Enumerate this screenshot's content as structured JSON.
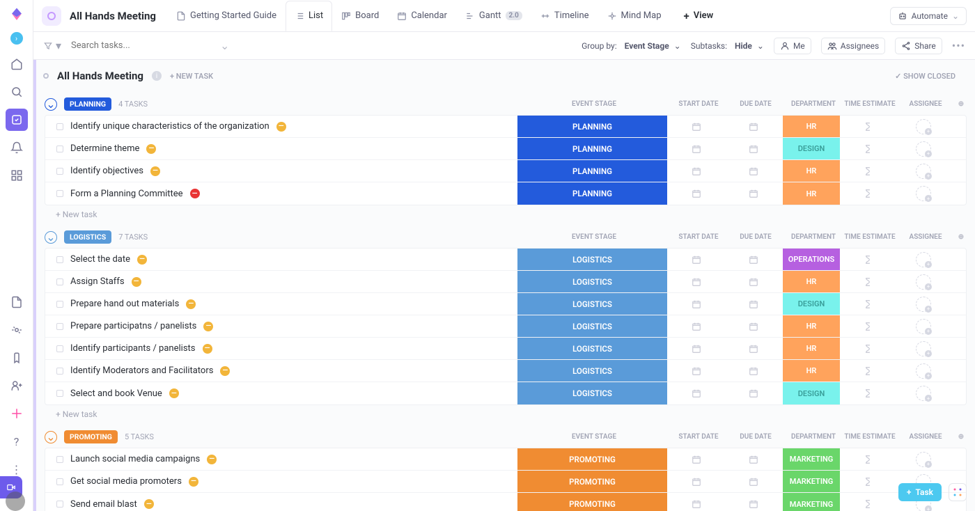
{
  "header": {
    "page_title": "All Hands Meeting",
    "automate": "Automate",
    "views": [
      {
        "label": "Getting Started Guide",
        "icon": "doc"
      },
      {
        "label": "List",
        "icon": "list",
        "active": true
      },
      {
        "label": "Board",
        "icon": "board"
      },
      {
        "label": "Calendar",
        "icon": "calendar"
      },
      {
        "label": "Gantt",
        "icon": "gantt",
        "badge": "2.0"
      },
      {
        "label": "Timeline",
        "icon": "timeline"
      },
      {
        "label": "Mind Map",
        "icon": "mindmap"
      }
    ],
    "add_view": "View"
  },
  "toolbar": {
    "search_placeholder": "Search tasks...",
    "group_by_label": "Group by:",
    "group_by_value": "Event Stage",
    "subtasks_label": "Subtasks:",
    "subtasks_value": "Hide",
    "me": "Me",
    "assignees": "Assignees",
    "share": "Share"
  },
  "list": {
    "title": "All Hands Meeting",
    "new_task": "+ NEW TASK",
    "show_closed": "SHOW CLOSED",
    "new_task_row": "+ New task"
  },
  "columns": {
    "stage": "EVENT STAGE",
    "start": "START DATE",
    "due": "DUE DATE",
    "dept": "DEPARTMENT",
    "time": "TIME ESTIMATE",
    "assignee": "ASSIGNEE"
  },
  "dept_colors": {
    "HR": "#ffa35c",
    "DESIGN": "#79f2ec",
    "OPERATIONS": "#b660e0",
    "MARKETING": "#6ad66a"
  },
  "groups": [
    {
      "name": "PLANNING",
      "color": "#235bdc",
      "accent": "#235bdc",
      "count": "4 TASKS",
      "tasks": [
        {
          "name": "Identify unique characteristics of the organization",
          "dept": "HR",
          "pri": "#f2b53a"
        },
        {
          "name": "Determine theme",
          "dept": "DESIGN",
          "pri": "#f2b53a"
        },
        {
          "name": "Identify objectives",
          "dept": "HR",
          "pri": "#f2b53a"
        },
        {
          "name": "Form a Planning Committee",
          "dept": "HR",
          "pri": "#e93434"
        }
      ]
    },
    {
      "name": "LOGISTICS",
      "color": "#5a9bd9",
      "accent": "#5a9bd9",
      "count": "7 TASKS",
      "tasks": [
        {
          "name": "Select the date",
          "dept": "OPERATIONS",
          "pri": "#f2b53a"
        },
        {
          "name": "Assign Staffs",
          "dept": "HR",
          "pri": "#f2b53a"
        },
        {
          "name": "Prepare hand out materials",
          "dept": "DESIGN",
          "pri": "#f2b53a"
        },
        {
          "name": "Prepare participatns / panelists",
          "dept": "HR",
          "pri": "#f2b53a"
        },
        {
          "name": "Identify participants / panelists",
          "dept": "HR",
          "pri": "#f2b53a"
        },
        {
          "name": "Identify Moderators and Facilitators",
          "dept": "HR",
          "pri": "#f2b53a"
        },
        {
          "name": "Select and book Venue",
          "dept": "DESIGN",
          "pri": "#f2b53a"
        }
      ]
    },
    {
      "name": "PROMOTING",
      "color": "#f08c32",
      "accent": "#f08c32",
      "count": "5 TASKS",
      "tasks": [
        {
          "name": "Launch social media campaigns",
          "dept": "MARKETING",
          "pri": "#f2b53a"
        },
        {
          "name": "Get social media promoters",
          "dept": "MARKETING",
          "pri": "#f2b53a"
        },
        {
          "name": "Send email blast",
          "dept": "MARKETING",
          "pri": "#f2b53a"
        }
      ]
    }
  ],
  "float": {
    "task": "Task"
  }
}
